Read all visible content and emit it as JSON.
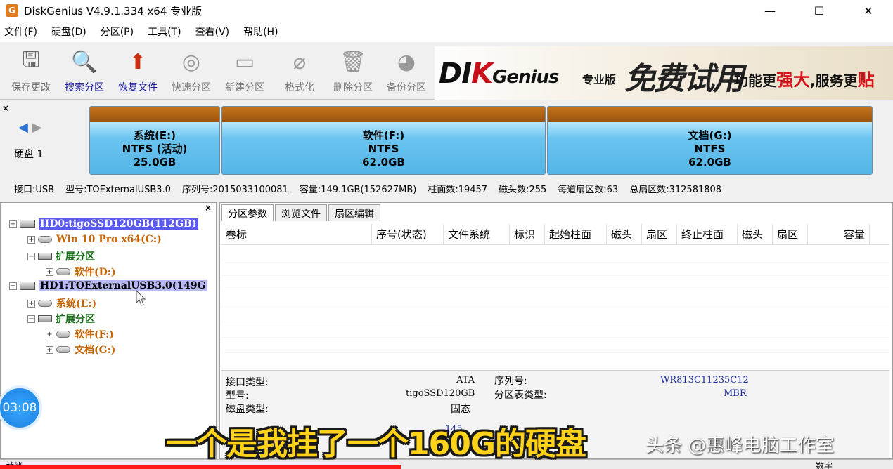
{
  "window": {
    "app_icon": "G",
    "title": "DiskGenius V4.9.1.334 x64 专业版",
    "minimize": "—",
    "maximize": "☐",
    "close": "✕"
  },
  "menu": [
    "文件(F)",
    "硬盘(D)",
    "分区(P)",
    "工具(T)",
    "查看(V)",
    "帮助(H)"
  ],
  "toolbar": [
    {
      "label": "保存更改",
      "icon": "save-disk-icon",
      "glyph": "🖫"
    },
    {
      "label": "搜索分区",
      "icon": "magnifier-icon",
      "glyph": "🔍"
    },
    {
      "label": "恢复文件",
      "icon": "recover-stack-icon",
      "glyph": "⬆"
    },
    {
      "label": "快速分区",
      "icon": "disc-icon",
      "glyph": "◎"
    },
    {
      "label": "新建分区",
      "icon": "new-partition-icon",
      "glyph": "▭"
    },
    {
      "label": "格式化",
      "icon": "format-icon",
      "glyph": "⌀"
    },
    {
      "label": "删除分区",
      "icon": "trash-icon",
      "glyph": "🗑"
    },
    {
      "label": "备份分区",
      "icon": "backup-icon",
      "glyph": "◕"
    }
  ],
  "banner": {
    "logo_a": "DI",
    "logo_k": "K",
    "logo_b": "Genius",
    "edition": "专业版",
    "free": "免费试用",
    "slogan_a": "功能更",
    "slogan_strong": "强大",
    "slogan_b": ",服务更",
    "slogan_end": "贴"
  },
  "diskmap": {
    "close": "×",
    "nav_left": "◀",
    "nav_right": "▶",
    "disk_label": "硬盘 1",
    "partitions": [
      {
        "name": "系统(E:)",
        "fs": "NTFS (活动)",
        "size": "25.0GB"
      },
      {
        "name": "软件(F:)",
        "fs": "NTFS",
        "size": "62.0GB"
      },
      {
        "name": "文档(G:)",
        "fs": "NTFS",
        "size": "62.0GB"
      }
    ],
    "info": {
      "interface": "接口:USB",
      "model": "型号:TOExternalUSB3.0",
      "serial": "序列号:2015033100081",
      "capacity": "容量:149.1GB(152627MB)",
      "cylinders": "柱面数:19457",
      "heads": "磁头数:255",
      "sectors_per_track": "每道扇区数:63",
      "total_sectors": "总扇区数:312581808"
    }
  },
  "tree": {
    "close": "×",
    "expand_minus": "−",
    "expand_plus": "+",
    "hd0": "HD0:tigoSSD120GB(112GB)",
    "hd0_c": "Win 10 Pro x64(C:)",
    "hd0_ext": "扩展分区",
    "hd0_d": "软件(D:)",
    "hd1": "HD1:TOExternalUSB3.0(149G",
    "hd1_e": "系统(E:)",
    "hd1_ext": "扩展分区",
    "hd1_f": "软件(F:)",
    "hd1_g": "文档(G:)"
  },
  "tabs": [
    "分区参数",
    "浏览文件",
    "扇区编辑"
  ],
  "table_columns": [
    "卷标",
    "序号(状态)",
    "文件系统",
    "标识",
    "起始柱面",
    "磁头",
    "扇区",
    "终止柱面",
    "磁头",
    "扇区",
    "容量"
  ],
  "disk_details": {
    "interface_type_label": "接口类型:",
    "interface_type": "ATA",
    "model_label": "型号:",
    "model": "tigoSSD120GB",
    "disk_type_label": "磁盘类型:",
    "disk_type": "固态",
    "serial_label": "序列号:",
    "serial": "WR813C11235C12",
    "partition_table_label": "分区表类型:",
    "partition_table": "MBR",
    "partial_value": "145"
  },
  "statusbar": {
    "left": "就绪",
    "right": "数字"
  },
  "overlay": {
    "timer": "03:08",
    "subtitle": "一个是我挂了一个160G的硬盘",
    "watermark": "头条 @惠峰电脑工作室"
  },
  "colors": {
    "partition_header": "#b06418",
    "partition_body": "#6bc4f0",
    "selection": "#5a5af0",
    "subtitle": "#ffd21a",
    "annotation_arrow": "#e02020"
  }
}
